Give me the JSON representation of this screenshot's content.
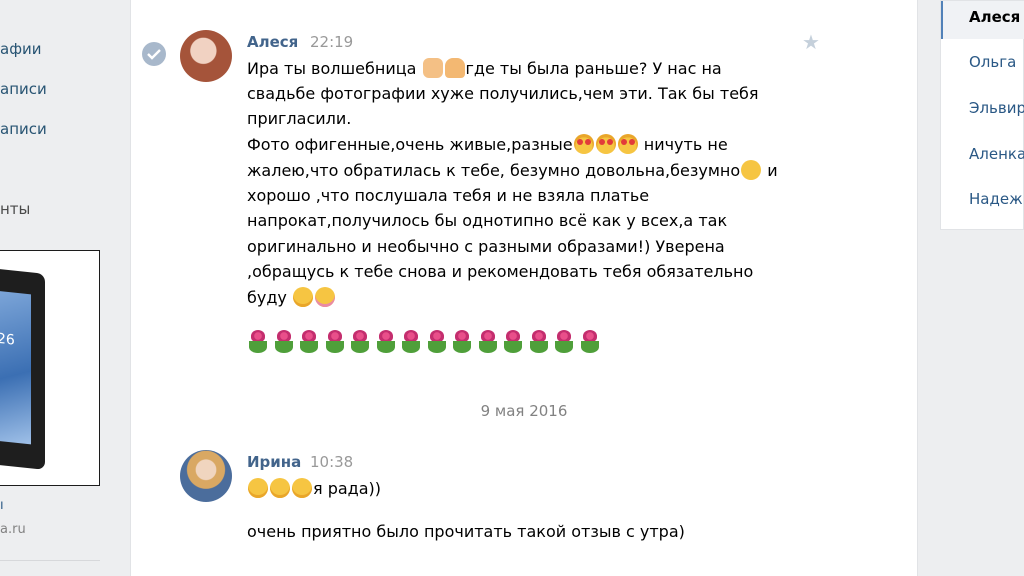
{
  "left_nav": {
    "items": [
      "афии",
      "аписи",
      "аписи",
      "нты"
    ],
    "ad": {
      "screen_text": "26",
      "title": "ı",
      "domain": "a.ru"
    }
  },
  "conversation": {
    "messages": [
      {
        "author": "Алеся",
        "time": "22:19",
        "lines": [
          "Ира ты волшебница",
          "где ты была раньше? У нас на",
          "свадьбе фотографии хуже получились,чем эти. Так бы тебя",
          "пригласили.",
          "Фото офигенные,очень живые,разные",
          "ничуть не",
          "жалею,что обратилась к тебе, безумно довольна,безумно",
          "и",
          "хорошо ,что послушала тебя и не взяла платье",
          "напрокат,получилось бы однотипно всё как у всех,а так",
          "оригинально и необычно с разными образами!) Уверена",
          ",обращусь к тебе снова и рекомендовать тебя обязательно",
          "буду"
        ],
        "flowers_count": 14
      },
      {
        "author": "Ирина",
        "time": "10:38",
        "lines": [
          "я рада))",
          "очень приятно было прочитать такой отзыв с утра)"
        ]
      }
    ],
    "date_separator": "9 мая 2016"
  },
  "dialogs": {
    "items": [
      "Алеся",
      "Ольга",
      "Эльвир",
      "Аленка",
      "Надеж"
    ]
  },
  "colors": {
    "link": "#42648b",
    "page_bg": "#edeef0",
    "muted": "#999999"
  }
}
